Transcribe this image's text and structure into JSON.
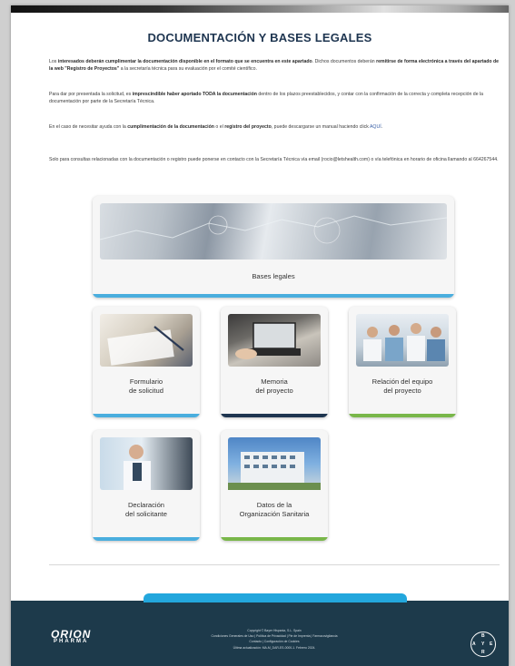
{
  "page": {
    "title": "DOCUMENTACIÓN Y BASES LEGALES",
    "p1": [
      {
        "t": "Los ",
        "s": "n"
      },
      {
        "t": "interesados deberán cumplimentar la documentación disponible en el formato que se encuentra en este apartado",
        "s": "b"
      },
      {
        "t": ". Dichos documentos deberán ",
        "s": "n"
      },
      {
        "t": "remitirse de forma electrónica a través del apartado de la web \"Registro de Proyectos\"",
        "s": "b"
      },
      {
        "t": " a la secretaría técnica para su evaluación por el comité científico.",
        "s": "n"
      }
    ],
    "p2": [
      {
        "t": "Para dar por presentada la solicitud, es ",
        "s": "n"
      },
      {
        "t": "imprescindible haber aportado TODA la documentación",
        "s": "b"
      },
      {
        "t": " dentro de los plazos preestablecidos, y contar con la confirmación de la correcta y completa recepción de la documentación por parte de la Secretaría Técnica.",
        "s": "n"
      }
    ],
    "p3": [
      {
        "t": "En el caso de necesitar ayuda con la ",
        "s": "n"
      },
      {
        "t": "cumplimentación de la documentación",
        "s": "b"
      },
      {
        "t": " o el ",
        "s": "n"
      },
      {
        "t": "registro del proyecto",
        "s": "b"
      },
      {
        "t": ", puede descargarse un manual haciendo click ",
        "s": "n"
      },
      {
        "t": "AQUÍ",
        "s": "a"
      },
      {
        "t": ".",
        "s": "n"
      }
    ],
    "p4": [
      {
        "t": "Solo para consultas relacionadas con la documentación o registro puede ponerse en contacto con la Secretaría Técnica vía email (rocio@letshealth.com) o vía telefónica en horario de oficina llamando al 664267544.",
        "s": "n"
      }
    ]
  },
  "cards": {
    "bases": "Bases legales",
    "formulario": [
      "Formulario",
      "de solicitud"
    ],
    "memoria": [
      "Memoria",
      "del proyecto"
    ],
    "relacion": [
      "Relación del equipo",
      "del proyecto"
    ],
    "declaracion": [
      "Declaración",
      "del solicitante"
    ],
    "datos": [
      "Datos de la",
      "Organización Sanitaria"
    ]
  },
  "colors": {
    "blue_bar": "#4aaede",
    "navy_bar": "#1e3550",
    "green_bar": "#79b74a",
    "footer": "#1d3a4b"
  },
  "footer": {
    "logo_line1": "ORION",
    "logo_line2": "PHARMA",
    "line1": "Copyright © Bayer Hispania, S.L. Spain",
    "line2": "Condiciones Generales de Uso | Política de Privacidad | Pie de Imprenta | Farmacovigilancia",
    "line3": "Contacto | Configuración de Cookies",
    "line4": "Última actualización: MA-M_DAR-ES-0000-1. Febrero 2024.",
    "bayer_b": "B",
    "bayer_a": "A",
    "bayer_y": "Y",
    "bayer_e": "E",
    "bayer_r": "R"
  }
}
